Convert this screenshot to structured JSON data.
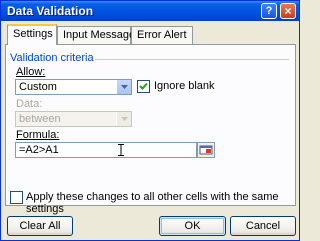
{
  "window": {
    "title": "Data Validation",
    "help_button": "?",
    "close_button": "×"
  },
  "tabs": [
    {
      "label": "Settings",
      "active": true
    },
    {
      "label": "Input Message",
      "active": false
    },
    {
      "label": "Error Alert",
      "active": false
    }
  ],
  "criteria": {
    "section_title": "Validation criteria",
    "allow_label": "Allow:",
    "allow_value": "Custom",
    "ignore_blank_label": "Ignore blank",
    "ignore_blank_checked": true,
    "data_label": "Data:",
    "data_value": "between",
    "formula_label": "Formula:",
    "formula_value": "=A2>A1"
  },
  "apply_label": "Apply these changes to all other cells with the same settings",
  "buttons": {
    "clear_all": "Clear All",
    "ok": "OK",
    "cancel": "Cancel"
  },
  "colors": {
    "titlebar": "#0054e3",
    "section_title": "#0046d5",
    "active_tab_highlight": "#ffc83c"
  }
}
